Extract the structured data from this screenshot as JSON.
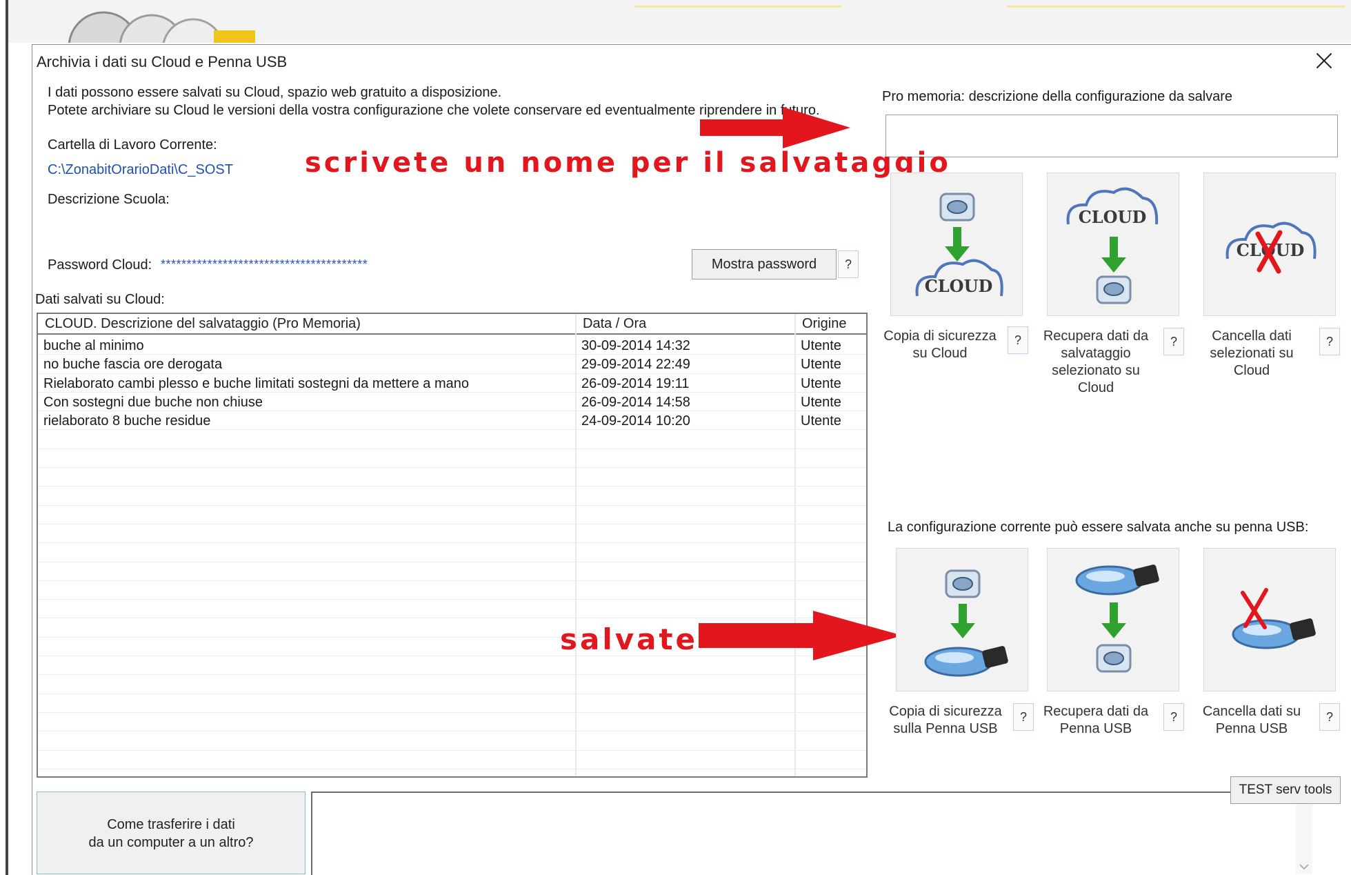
{
  "dialog": {
    "title": "Archivia i dati su Cloud e Penna USB",
    "intro_line1": "I dati possono essere salvati su Cloud, spazio web gratuito a disposizione.",
    "intro_line2": "Potete archiviare su Cloud le versioni della vostra configurazione che volete conservare ed eventualmente riprendere in futuro.",
    "folder_label": "Cartella di Lavoro Corrente:",
    "folder_path": "C:\\ZonabitOrarioDati\\C_SOST",
    "school_label": "Descrizione Scuola:",
    "password_label": "Password Cloud:",
    "password_value": "****************************************",
    "show_password": "Mostra password",
    "help": "?",
    "saved_label": "Dati salvati su Cloud:",
    "memo_label": "Pro memoria: descrizione della configurazione da salvare",
    "memo_value": "",
    "usb_label": "La configurazione corrente può essere salvata anche su penna USB:",
    "transfer_line1": "Come trasferire i dati",
    "transfer_line2": "da un computer a un altro?",
    "test_button": "TEST serv tools"
  },
  "annotations": {
    "write_name": "scrivete un nome per il salvataggio",
    "save": "salvate"
  },
  "table": {
    "headers": [
      "CLOUD. Descrizione del salvataggio (Pro Memoria)",
      "Data / Ora",
      "Origine"
    ],
    "rows": [
      [
        "buche al minimo",
        "30-09-2014 14:32",
        "Utente"
      ],
      [
        "no buche  fascia ore derogata",
        "29-09-2014 22:49",
        "Utente"
      ],
      [
        "Rielaborato cambi plesso e buche limitati  sostegni da mettere a mano",
        "26-09-2014 19:11",
        "Utente"
      ],
      [
        "Con sostegni  due buche non chiuse",
        "26-09-2014 14:58",
        "Utente"
      ],
      [
        "rielaborato  8 buche residue",
        "24-09-2014 10:20",
        "Utente"
      ]
    ]
  },
  "cloud_actions": [
    {
      "icon": "disk-to-cloud-icon",
      "line1": "Copia di sicurezza",
      "line2": "su Cloud",
      "line3": "",
      "line4": ""
    },
    {
      "icon": "cloud-to-disk-icon",
      "line1": "Recupera dati da",
      "line2": "salvataggio",
      "line3": "selezionato su",
      "line4": "Cloud"
    },
    {
      "icon": "cloud-delete-icon",
      "line1": "Cancella dati",
      "line2": "selezionati su",
      "line3": "Cloud",
      "line4": ""
    }
  ],
  "usb_actions": [
    {
      "icon": "disk-to-usb-icon",
      "line1": "Copia di sicurezza",
      "line2": "sulla Penna USB"
    },
    {
      "icon": "usb-to-disk-icon",
      "line1": "Recupera dati da",
      "line2": "Penna USB"
    },
    {
      "icon": "usb-delete-icon",
      "line1": "Cancella dati su",
      "line2": "Penna USB"
    }
  ],
  "icon_text": {
    "cloud": "CLOUD"
  },
  "colors": {
    "annotation_red": "#e2161c",
    "arrow_green": "#2fa12f",
    "link_blue": "#1f4fb0"
  }
}
